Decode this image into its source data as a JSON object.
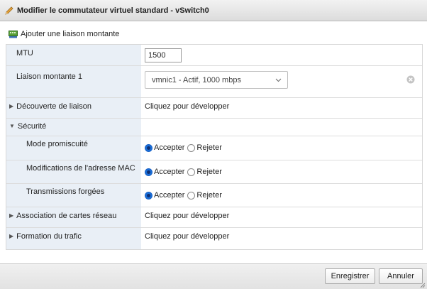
{
  "dialog": {
    "title": "Modifier le commutateur virtuel standard - vSwitch0",
    "title_icon": "pencil-icon"
  },
  "toolbar": {
    "add_uplink_label": "Ajouter une liaison montante",
    "add_uplink_icon": "network-adapter-icon"
  },
  "form": {
    "mtu": {
      "label": "MTU",
      "value": "1500"
    },
    "uplink1": {
      "label": "Liaison montante 1",
      "selected": "vmnic1 - Actif, 1000 mbps"
    },
    "link_discovery": {
      "label": "Découverte de liaison",
      "value": "Cliquez pour développer",
      "expanded": false
    },
    "security": {
      "label": "Sécurité",
      "expanded": true,
      "promiscuous": {
        "label": "Mode promiscuité",
        "accept": "Accepter",
        "reject": "Rejeter",
        "selected": "accept"
      },
      "mac_changes": {
        "label": "Modifications de l'adresse MAC",
        "accept": "Accepter",
        "reject": "Rejeter",
        "selected": "accept"
      },
      "forged": {
        "label": "Transmissions forgées",
        "accept": "Accepter",
        "reject": "Rejeter",
        "selected": "accept"
      }
    },
    "nic_teaming": {
      "label": "Association de cartes réseau",
      "value": "Cliquez pour développer",
      "expanded": false
    },
    "traffic_shaping": {
      "label": "Formation du trafic",
      "value": "Cliquez pour développer",
      "expanded": false
    }
  },
  "footer": {
    "save_label": "Enregistrer",
    "cancel_label": "Annuler"
  },
  "colors": {
    "label_column_bg": "#e9eff6",
    "radio_selected": "#1a6fd8"
  }
}
